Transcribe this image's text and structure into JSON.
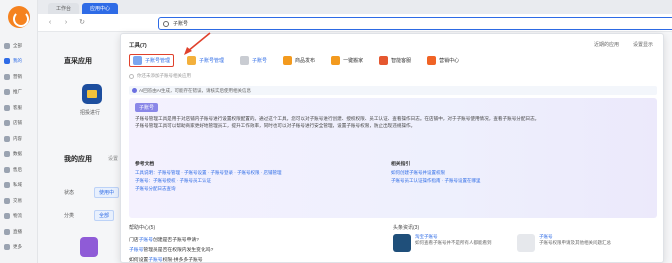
{
  "tabs": {
    "workbench": "工作台",
    "app_center": "应用中心"
  },
  "search": {
    "value": "子账号"
  },
  "rail": {
    "items": [
      "全部",
      "我的",
      "营销",
      "推广",
      "客服",
      "店铺",
      "内容",
      "数据",
      "售后",
      "私域",
      "交易",
      "物流",
      "直播",
      "更多"
    ]
  },
  "background": {
    "section_buy": "直采应用",
    "app_label": "招投进行",
    "section_mine": "我的应用",
    "settings": "设置",
    "status_label": "状态",
    "status_btn": "使用中",
    "category_label": "分类",
    "category_btn": "全部"
  },
  "panel": {
    "title": "工具(7)",
    "link_recent": "近期的应用",
    "link_settings": "设置显示",
    "tools": [
      {
        "label": "子账号管理",
        "color": "#7ba6f0"
      },
      {
        "label": "子账号管理",
        "color": "#f3b03c"
      },
      {
        "label": "子账号",
        "color": "#c9ccd2"
      },
      {
        "label": "商品发布",
        "color": "#f39a1e"
      },
      {
        "label": "一键搬家",
        "color": "#f39a1e"
      },
      {
        "label": "智能客服",
        "color": "#e5572f"
      },
      {
        "label": "营销中心",
        "color": "#f06325"
      }
    ],
    "hint": "你还未添加子账号相关应用",
    "ai_notice": "AI回答由AI生成，可能存在错误，请核实后使用相关信息",
    "ai_tag": "子账号",
    "ai_text_1": "子账号管理工具是用于对店铺内子账号进行设置权限配置的。通过这个工具，您可以对子账号进行创建、授权权限、员工认证、查看操作日志。在店铺中，对于子账号使用情况，查看子账号分配日志。",
    "ai_text_2": "子账号管理工具可以帮助商家更好地管理员工，提升工作效率，同时也可以对子账号进行安全管理，设置子账号权限，防止出现违规操作。",
    "ref_head_left": "参考文档",
    "ref_left": [
      "工具说明：子账号管理 · 子账号设置 · 子账号登录 · 子账号权限 · 店铺管理",
      "子账号：子账号授权 · 子账号员工认证",
      "子账号分配日志查询"
    ],
    "ref_head_right": "相关指引",
    "ref_right": [
      "如何创建子账号并设置权限",
      "子账号员工认证操作指南 · 子账号设置在哪里"
    ],
    "help_title": "帮助中心(5)",
    "help_items": [
      {
        "pre": "门店",
        "hl": "子账号",
        "post": "创建是否子账号申请?"
      },
      {
        "pre": "",
        "hl": "子账号",
        "post": "管理员是否在权限内发生变化吗?"
      },
      {
        "pre": "如何设置",
        "hl": "子账号",
        "post": "权限-拼多多子账号"
      }
    ],
    "head_title": "头条资讯(3)",
    "head_cards": [
      {
        "title": "淘宝子账号",
        "desc": "如何查看子账号并不是所有人都能看到",
        "color": "#1f4f7a"
      },
      {
        "title": "子账号",
        "desc": "子账号权限申请及其他相关问题汇总",
        "color": "#e6e8ec"
      }
    ]
  }
}
